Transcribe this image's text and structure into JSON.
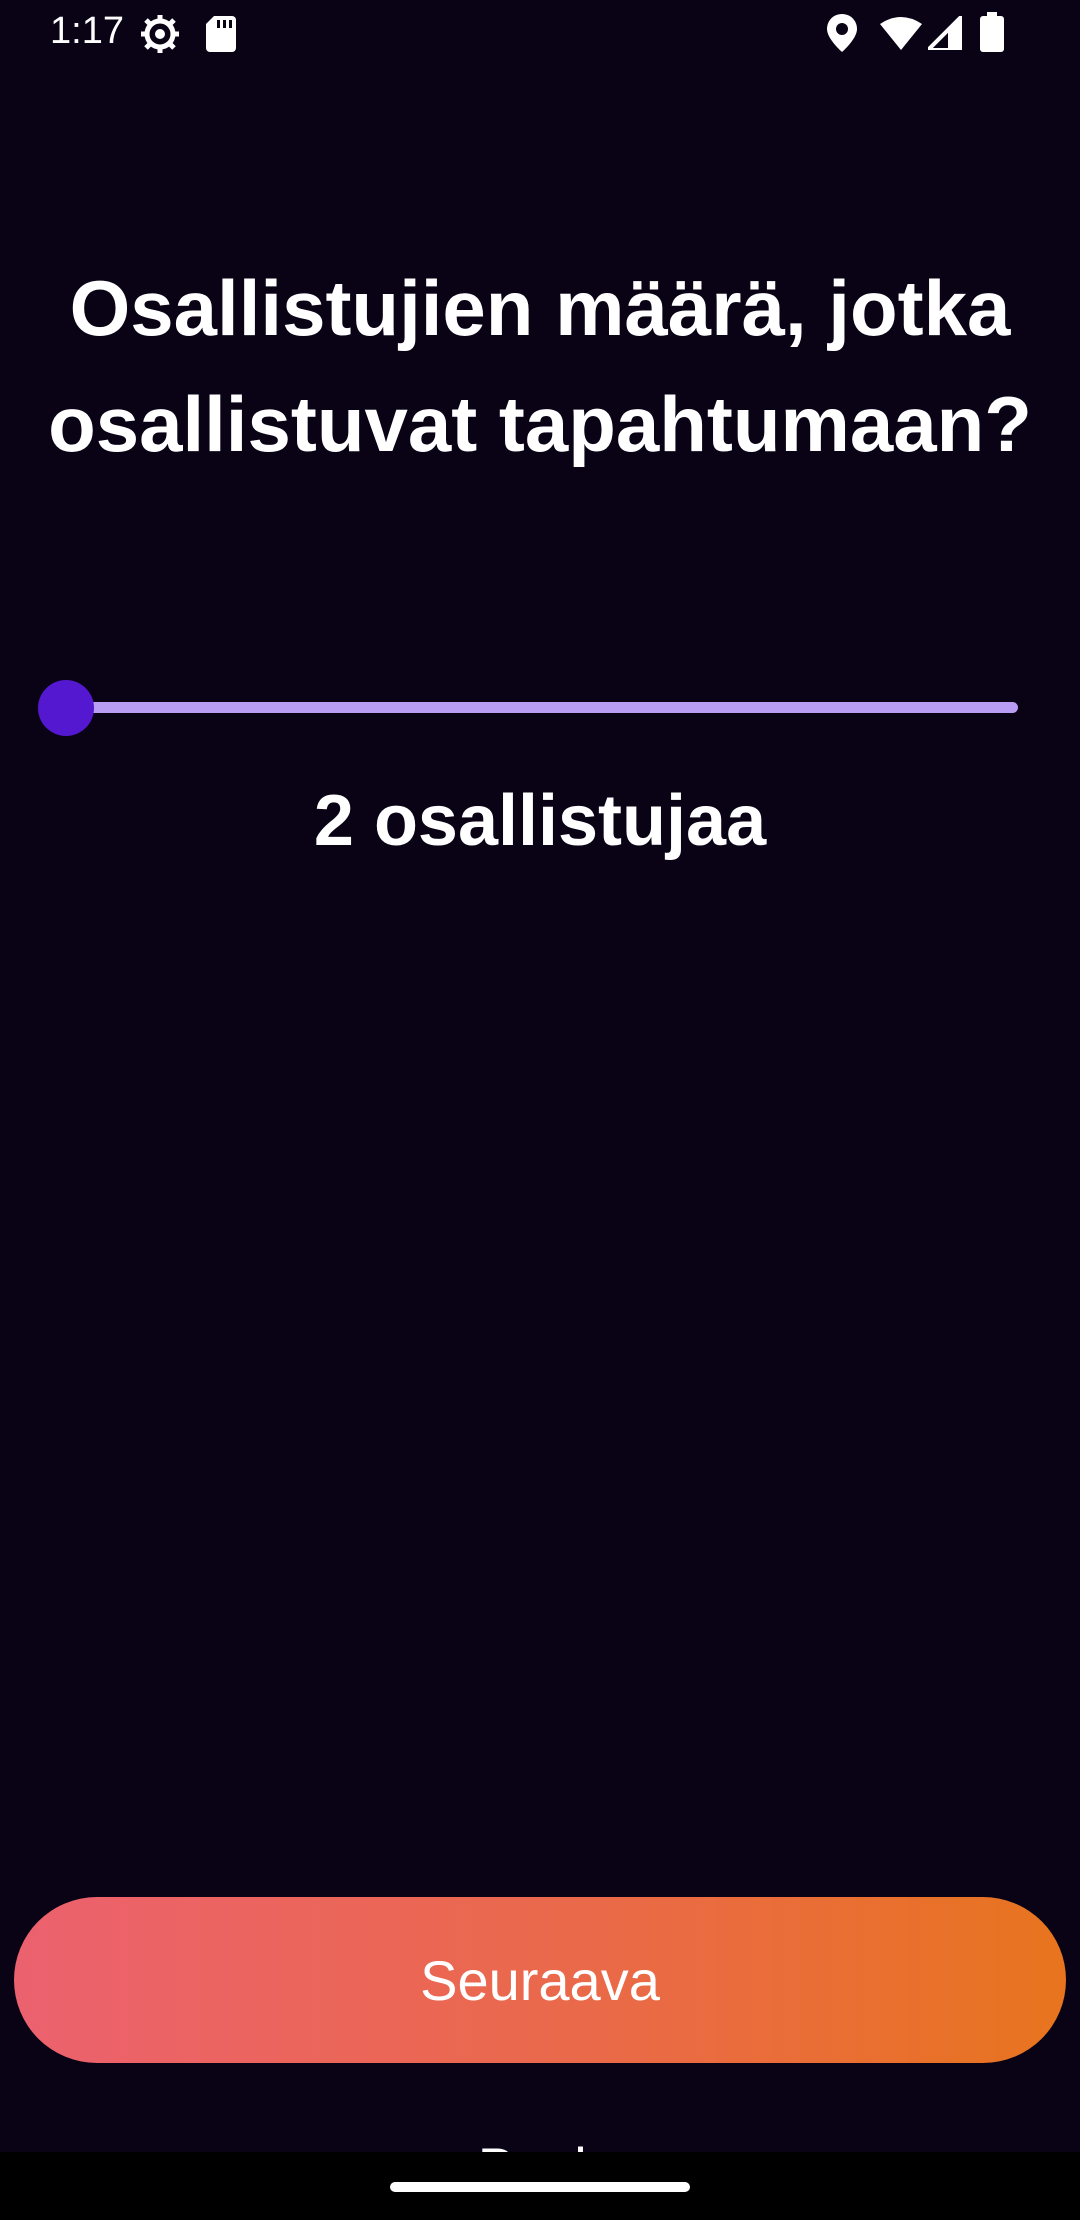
{
  "status_bar": {
    "time": "1:17",
    "left_icons": [
      "settings-icon",
      "sd-card-icon"
    ],
    "right_icons": [
      "location-icon",
      "wifi-icon",
      "signal-icon",
      "battery-icon"
    ]
  },
  "question": {
    "title": "Osallistujien määrä, jotka osallistuvat tapahtumaan?"
  },
  "slider": {
    "value_fraction": 0.0,
    "track_color": "#b99cf3",
    "thumb_color": "#5418d0"
  },
  "value_label": "2 osallistujaa",
  "buttons": {
    "next_label": "Seuraava",
    "back_label": "Back"
  },
  "colors": {
    "background": "#0a0316",
    "button_gradient_start": "#ec616f",
    "button_gradient_end": "#e8741e"
  }
}
